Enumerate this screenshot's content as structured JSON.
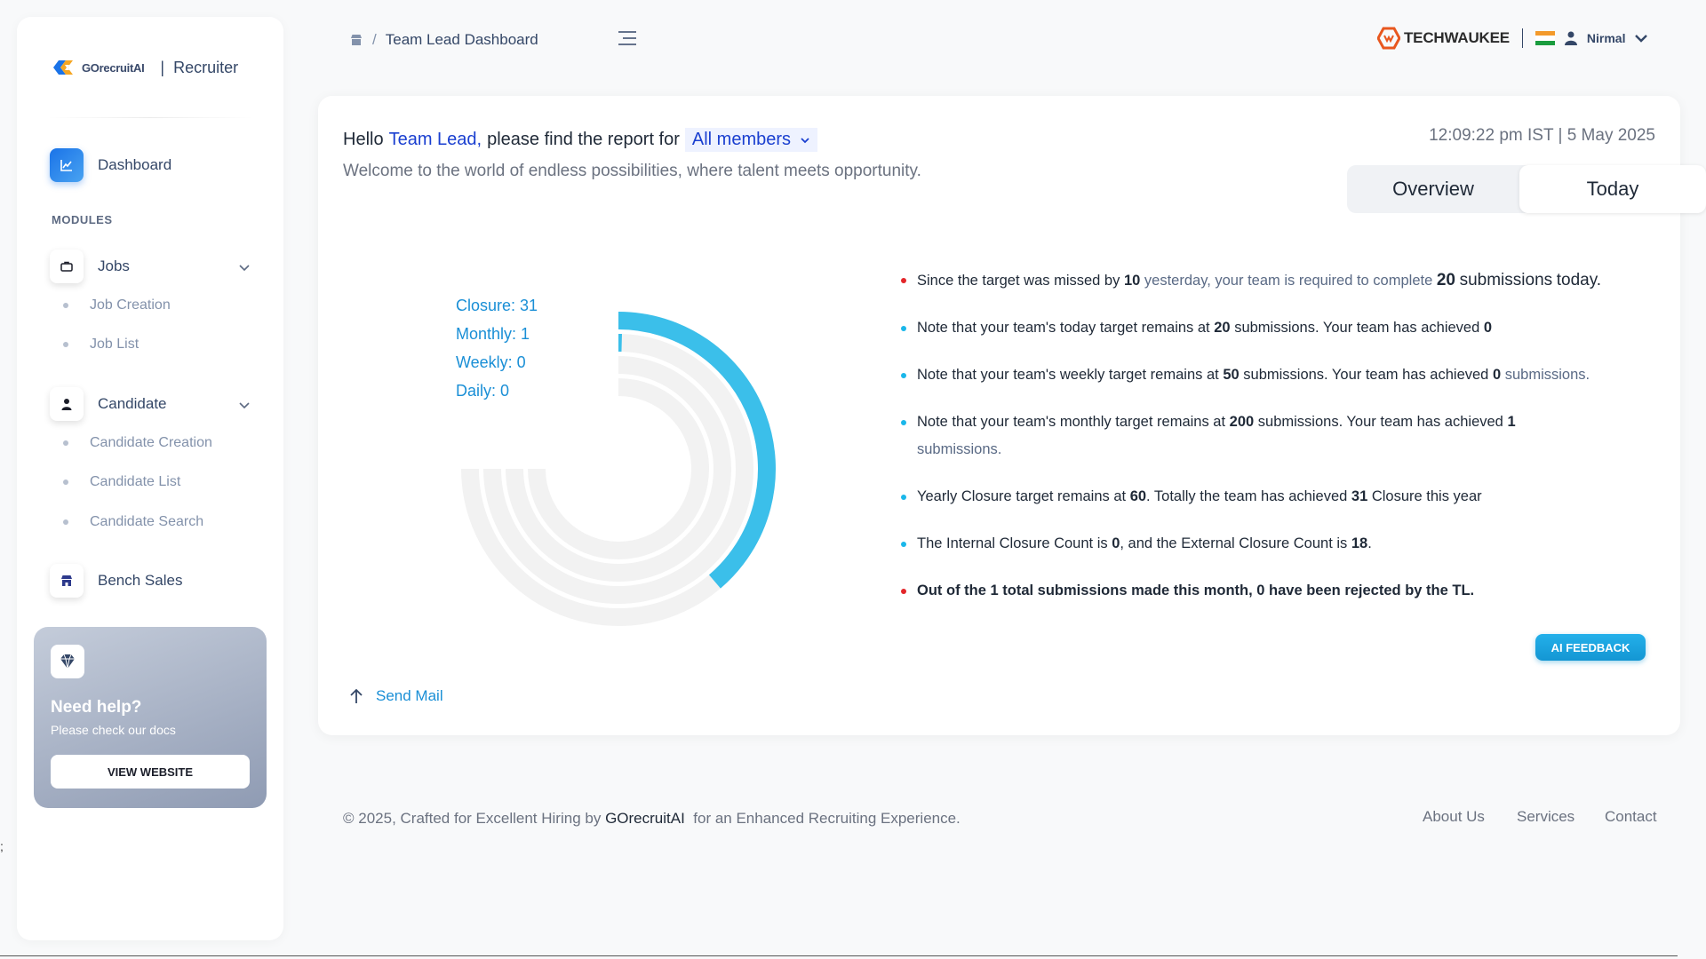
{
  "sidebar": {
    "brand": {
      "logo_text": "GOrecruitAI",
      "separator": "|",
      "role": "Recruiter"
    },
    "dashboard_label": "Dashboard",
    "modules_heading": "MODULES",
    "jobs": {
      "label": "Jobs",
      "items": [
        "Job Creation",
        "Job List"
      ]
    },
    "candidate": {
      "label": "Candidate",
      "items": [
        "Candidate Creation",
        "Candidate List",
        "Candidate Search"
      ]
    },
    "bench_label": "Bench Sales",
    "help": {
      "title": "Need help?",
      "subtitle": "Please check our docs",
      "button": "VIEW WEBSITE"
    }
  },
  "header": {
    "breadcrumb_sep": "/",
    "breadcrumb": "Team Lead Dashboard",
    "company": "TECHWAUKEE",
    "separator": "|",
    "user": "Nirmal"
  },
  "main": {
    "greeting_prefix": "Hello",
    "greeting_name": "Team Lead,",
    "greeting_suffix": "please find the report for",
    "member_filter": "All members",
    "welcome": "Welcome to the world of endless possibilities, where talent meets opportunity.",
    "clock": "12:09:22 pm IST | 5 May 2025",
    "tabs": [
      "Overview",
      "Today"
    ],
    "ai_button": "AI FEEDBACK",
    "send_mail": "Send Mail"
  },
  "chart_data": {
    "type": "radial-bar",
    "max_angle_degrees": 270,
    "series": [
      {
        "name": "Closure",
        "value": 31,
        "label": "Closure: 31",
        "target": 60
      },
      {
        "name": "Monthly",
        "value": 1,
        "label": "Monthly: 1",
        "target": 200
      },
      {
        "name": "Weekly",
        "value": 0,
        "label": "Weekly: 0",
        "target": 50
      },
      {
        "name": "Daily",
        "value": 0,
        "label": "Daily: 0",
        "target": 20
      }
    ],
    "bar_color": "#3bbfea",
    "track_color": "#f2f2f2"
  },
  "notes": {
    "n1": {
      "a": "Since the target was missed by",
      "b": "10",
      "c": "yesterday, your team is required to complete",
      "d": "20",
      "e": "submissions",
      "f": "today."
    },
    "n2": {
      "a": "Note that your team's today target remains at",
      "b": "20",
      "c": "submissions. Your team has achieved",
      "d": "0"
    },
    "n3": {
      "a": "Note that your team's weekly target remains at",
      "b": "50",
      "c": "submissions. Your team has achieved",
      "d": "0",
      "e": "submissions."
    },
    "n4": {
      "a": "Note that your team's monthly target remains at",
      "b": "200",
      "c": "submissions. Your team has achieved",
      "d": "1",
      "e": "submissions."
    },
    "n5": {
      "a": "Yearly Closure target remains at",
      "b": "60",
      "c": ". Totally the team has achieved",
      "d": "31",
      "e": "Closure this year"
    },
    "n6": {
      "a": "The Internal Closure Count is",
      "b": "0",
      "c": ", and the External Closure Count is",
      "d": "18",
      "e": "."
    },
    "n7": {
      "a": "Out of the 1 total submissions made this month, 0 have been rejected by the TL."
    }
  },
  "footer": {
    "prefix": "© 2025, Crafted for Excellent Hiring by",
    "brand": "GOrecruitAI",
    "suffix": "for an Enhanced Recruiting Experience.",
    "links": [
      "About Us",
      "Services",
      "Contact"
    ]
  },
  "stray_text": ";"
}
